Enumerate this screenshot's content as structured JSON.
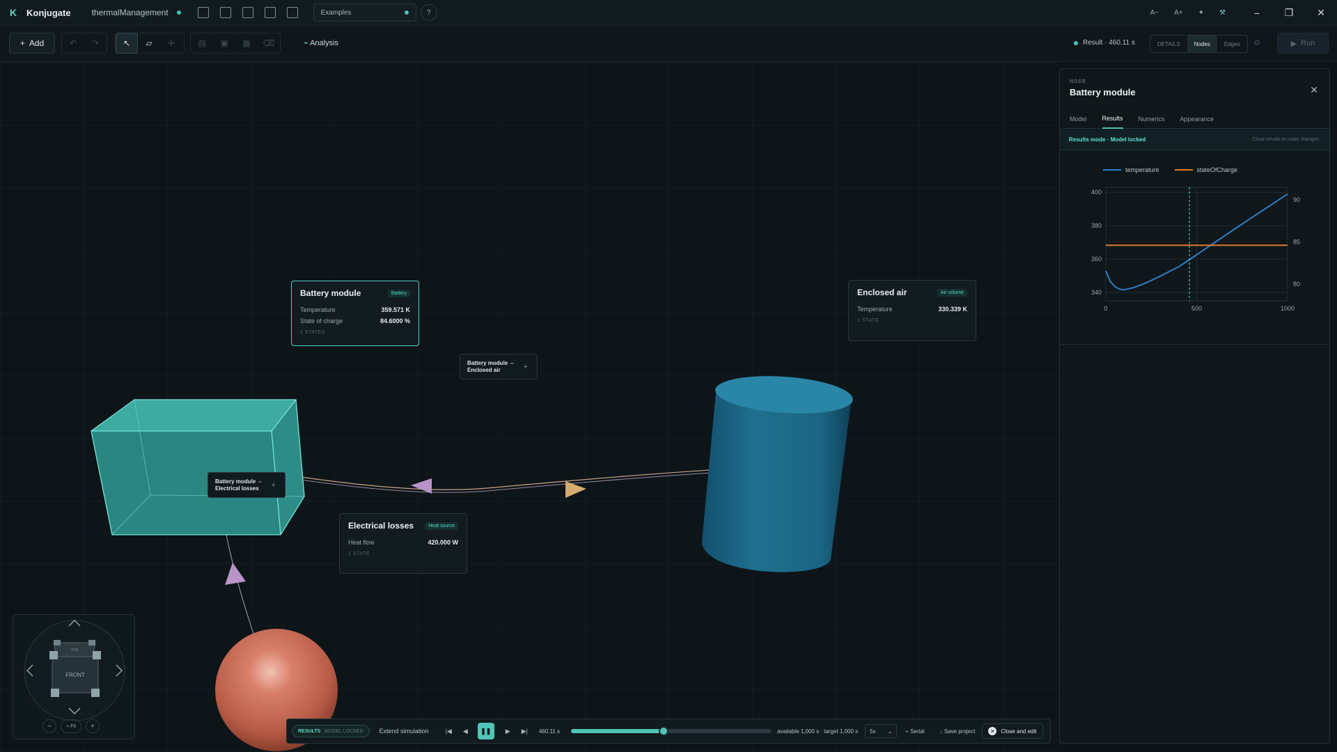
{
  "app": {
    "name": "Konjugate",
    "project": "thermalManagement"
  },
  "titlebar": {
    "examples": "Examples",
    "help": "?",
    "font_smaller": "A−",
    "font_larger": "A+",
    "minimize": "−",
    "maximize": "❐",
    "close": "✕"
  },
  "toolbar": {
    "add": "Add",
    "analysis": "Analysis",
    "result_status": "Result · 460.11 s",
    "view_modes": [
      "DETAILS",
      "Nodes",
      "Edges"
    ],
    "run": "Run"
  },
  "nodes": {
    "battery": {
      "title": "Battery module",
      "badge": "Battery",
      "rows": [
        {
          "label": "Temperature",
          "value": "359.571 K"
        },
        {
          "label": "State of charge",
          "value": "84.6000 %"
        }
      ],
      "states": "2 STATES"
    },
    "air": {
      "title": "Enclosed air",
      "badge": "Air volume",
      "rows": [
        {
          "label": "Temperature",
          "value": "330.339 K"
        }
      ],
      "states": "1 STATE"
    },
    "losses": {
      "title": "Electrical losses",
      "badge": "Heat source",
      "rows": [
        {
          "label": "Heat flow",
          "value": "420.000 W"
        }
      ],
      "states": "1 STATE"
    }
  },
  "edges": {
    "battery_air": {
      "line1": "Battery module ⇔",
      "line2": "Enclosed air",
      "plus": "+"
    },
    "battery_losses": {
      "line1": "Battery module ⇔",
      "line2": "Electrical losses",
      "plus": "+"
    }
  },
  "navcube": {
    "face": "FRONT",
    "top": "TOP",
    "zoom_out": "−",
    "fit": "+ Fit",
    "zoom_in": "+"
  },
  "playback": {
    "mode": "RESULTS",
    "mode_sub": "MODEL LOCKED",
    "extend": "Extend simulation",
    "time": "460.11 s",
    "progress": 0.46,
    "availability": "available 1,000 s · target 1,000 s",
    "speed": "5x",
    "serial": "Serial",
    "save": "Save project",
    "close_edit": "Close and edit"
  },
  "panel": {
    "kicker": "NODE",
    "title": "Battery module",
    "tabs": [
      "Model",
      "Results",
      "Numerics",
      "Appearance"
    ],
    "active_tab": "Results",
    "mode_label": "Results mode · Model locked",
    "mode_hint": "Close results to make changes."
  },
  "colors": {
    "accent": "#4fc5b6",
    "temperature": "#2f7fc7",
    "stateOfCharge": "#e0792d",
    "battery": "#3aa39c",
    "air": "#1f6f8f",
    "losses": "#c86a55"
  },
  "chart_data": {
    "type": "line",
    "cursor_x": 460.11,
    "xlim": [
      0,
      1000
    ],
    "x_ticks": [
      0,
      500,
      1000
    ],
    "y_left_ticks": [
      340,
      360,
      380,
      400
    ],
    "y_left_lim": [
      335,
      403
    ],
    "y_right_ticks": [
      80,
      85,
      90
    ],
    "y_right_lim": [
      78,
      91.5
    ],
    "series": [
      {
        "name": "temperature",
        "axis": "left",
        "x": [
          0,
          25,
          50,
          75,
          100,
          150,
          200,
          250,
          300,
          400,
          460,
          500,
          600,
          700,
          800,
          900,
          1000
        ],
        "y": [
          353,
          346.5,
          343.5,
          342,
          341.6,
          342.8,
          344.8,
          347.2,
          349.8,
          355.3,
          359.6,
          362.6,
          370.0,
          377.4,
          384.6,
          391.8,
          399.0
        ]
      },
      {
        "name": "stateOfCharge",
        "axis": "right",
        "x": [
          0,
          1000
        ],
        "y": [
          84.6,
          84.6
        ]
      }
    ]
  }
}
